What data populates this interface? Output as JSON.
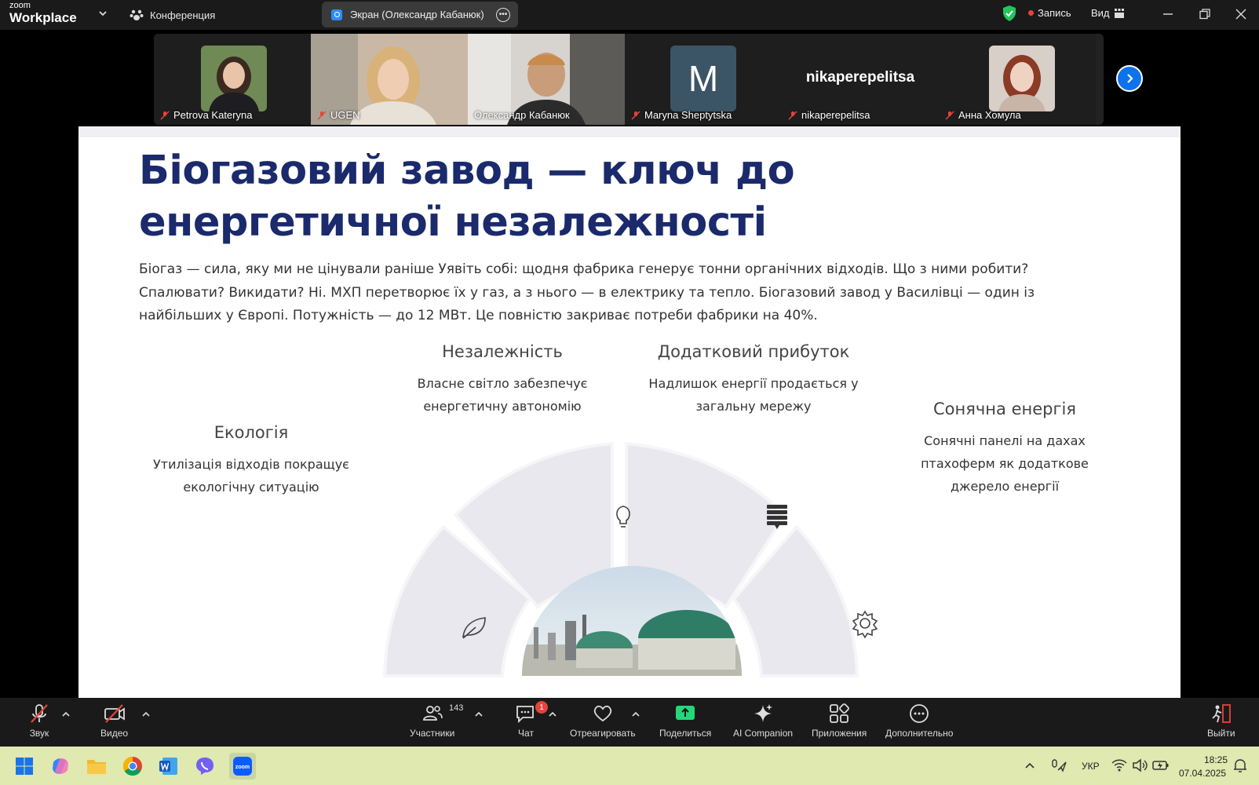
{
  "topbar": {
    "logo_line1": "zoom",
    "logo_line2": "Workplace",
    "conference_label": "Конференция",
    "screen_share_label": "Экран (Олександр Кабанюк)",
    "record_label": "Запись",
    "view_label": "Вид"
  },
  "participants_strip": [
    {
      "name": "Petrova Kateryna",
      "muted": true,
      "type": "photo"
    },
    {
      "name": "UGEN",
      "muted": true,
      "type": "video"
    },
    {
      "name": "Олександр Кабанюк",
      "muted": false,
      "type": "video",
      "active": true
    },
    {
      "name": "Maryna Sheptytska",
      "muted": true,
      "type": "initial",
      "initial": "M"
    },
    {
      "name": "nikaperepelitsa",
      "muted": true,
      "type": "name",
      "display": "nikaperepelitsa"
    },
    {
      "name": "Анна Хомула",
      "muted": true,
      "type": "photo"
    }
  ],
  "slide": {
    "title": "Біогазовий завод — ключ до енергетичної незалежності",
    "body": "Біогаз — сила, яку ми не цінували раніше Уявіть собі: щодня фабрика генерує тонни органічних відходів. Що з ними робити? Спалювати? Викидати? Ні. МХП перетворює їх у газ, а з нього — в електрику та тепло. Біогазовий завод у Василівці — один із найбільших у Європі. Потужність — до 12 МВт. Це повністю закриває потреби фабрики на 40%.",
    "features": {
      "ecology": {
        "title": "Екологія",
        "desc": "Утилізація відходів покращує екологічну ситуацію",
        "icon": "leaf-icon"
      },
      "independence": {
        "title": "Незалежність",
        "desc": "Власне світло забезпечує енергетичну автономію",
        "icon": "lightbulb-icon"
      },
      "profit": {
        "title": "Додатковий прибуток",
        "desc": "Надлишок енергії продається у загальну мережу",
        "icon": "coins-icon"
      },
      "solar": {
        "title": "Сонячна енергія",
        "desc": "Сонячні панелі на дахах птахоферм як додаткове джерело енергії",
        "icon": "gear-icon"
      }
    }
  },
  "toolbar": {
    "audio": "Звук",
    "video": "Видео",
    "participants": "Участники",
    "participants_count": "143",
    "chat": "Чат",
    "chat_badge": "1",
    "react": "Отреагировать",
    "share": "Поделиться",
    "ai": "AI Companion",
    "apps": "Приложения",
    "more": "Дополнительно",
    "leave": "Выйти"
  },
  "taskbar": {
    "lang": "УКР",
    "time": "18:25",
    "date": "07.04.2025"
  },
  "colors": {
    "accent": "#0e72ed",
    "active_speaker": "#23d87a",
    "title": "#1a2a6c",
    "record": "#e5443c"
  }
}
